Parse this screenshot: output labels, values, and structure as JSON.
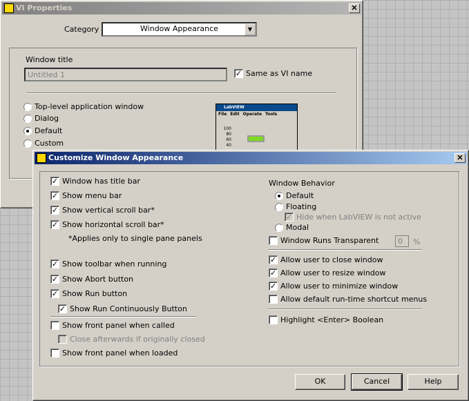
{
  "vi_properties": {
    "title": "VI Properties",
    "category_label": "Category",
    "category_value": "Window Appearance",
    "window_title_label": "Window title",
    "window_title_value": "Untitled 1",
    "same_as_vi_name": "Same as VI name",
    "same_as_vi_name_checked": true,
    "options": [
      {
        "label": "Top-level application window",
        "selected": false
      },
      {
        "label": "Dialog",
        "selected": false
      },
      {
        "label": "Default",
        "selected": true
      },
      {
        "label": "Custom",
        "selected": false
      }
    ],
    "preview": {
      "title": "LabVIEW",
      "menu": [
        "File",
        "Edit",
        "Operate",
        "Tools"
      ],
      "scale": [
        "100",
        "80",
        "60",
        "40"
      ]
    }
  },
  "customize": {
    "title": "Customize Window Appearance",
    "left": [
      {
        "label": "Window has title bar",
        "checked": true
      },
      {
        "label": "Show menu bar",
        "checked": true
      },
      {
        "label": "Show vertical scroll bar*",
        "checked": true
      },
      {
        "label": "Show horizontal scroll bar*",
        "checked": true
      }
    ],
    "note": "*Applies only to single pane panels",
    "toolbar": [
      {
        "label": "Show toolbar when running",
        "checked": true
      },
      {
        "label": "Show Abort button",
        "checked": true
      },
      {
        "label": "Show Run button",
        "checked": true
      },
      {
        "label": "Show Run Continuously Button",
        "checked": true
      }
    ],
    "panel": [
      {
        "label": "Show front panel when called",
        "checked": false
      },
      {
        "label": "Close afterwards if originally closed",
        "checked": false,
        "disabled": true
      },
      {
        "label": "Show front panel when loaded",
        "checked": false
      }
    ],
    "behavior_label": "Window Behavior",
    "behavior": [
      {
        "label": "Default",
        "selected": true
      },
      {
        "label": "Floating",
        "selected": false
      },
      {
        "label": "Modal",
        "selected": false
      }
    ],
    "hide_when_inactive": "Hide when LabVIEW is not active",
    "transparent": "Window Runs Transparent",
    "transparent_value": "0",
    "percent": "%",
    "allow": [
      {
        "label": "Allow user to close window",
        "checked": true
      },
      {
        "label": "Allow user to resize window",
        "checked": true
      },
      {
        "label": "Allow user to minimize window",
        "checked": true
      },
      {
        "label": "Allow default run-time shortcut menus",
        "checked": false
      }
    ],
    "highlight": "Highlight <Enter> Boolean",
    "buttons": {
      "ok": "OK",
      "cancel": "Cancel",
      "help": "Help"
    }
  }
}
